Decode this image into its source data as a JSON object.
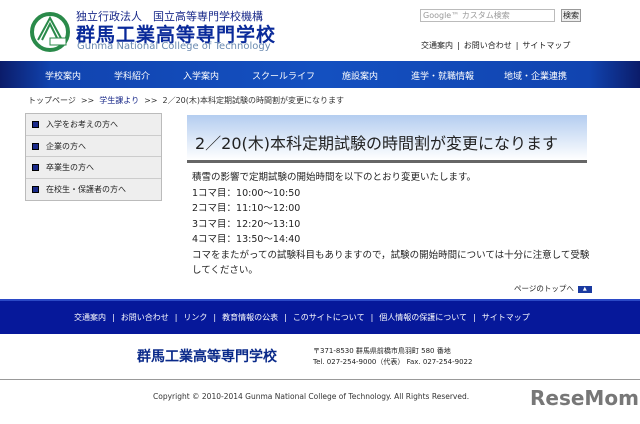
{
  "header": {
    "org": "独立行政法人　国立高等専門学校機構",
    "name": "群馬工業高等専門学校",
    "english_name": "Gunma National College of Technology",
    "search_placeholder": "Google™ カスタム検索",
    "search_button": "検索",
    "links": [
      "交通案内",
      "お問い合わせ",
      "サイトマップ"
    ]
  },
  "nav": [
    "学校案内",
    "学科紹介",
    "入学案内",
    "スクールライフ",
    "施設案内",
    "進学・就職情報",
    "地域・企業連携"
  ],
  "breadcrumb": [
    "トップページ",
    "学生課より",
    "2／20(木)本科定期試験の時間割が変更になります"
  ],
  "breadcrumb_sep": ">>",
  "sidebar": [
    "入学をお考えの方へ",
    "企業の方へ",
    "卒業生の方へ",
    "在校生・保護者の方へ"
  ],
  "article": {
    "title": "2／20(木)本科定期試験の時間割が変更になります",
    "lines": [
      "積雪の影響で定期試験の開始時間を以下のとおり変更いたします。",
      "1コマ目：10:00～10:50",
      "2コマ目：11:10～12:00",
      "3コマ目：12:20～13:10",
      "4コマ目：13:50～14:40",
      "コマをまたがっての試験科目もありますので，試験の開始時間については十分に注意して受験してください。"
    ]
  },
  "page_top": "ページのトップへ",
  "footer": {
    "links": [
      "交通案内",
      "お問い合わせ",
      "リンク",
      "教育情報の公表",
      "このサイトについて",
      "個人情報の保護について",
      "サイトマップ"
    ],
    "name": "群馬工業高等専門学校",
    "address": "〒371-8530 群馬県前橋市鳥羽町 580 番地",
    "tel": "Tel. 027-254-9000（代表） Fax. 027-254-9022",
    "copyright": "Copyright © 2010-2014 Gunma National College of Technology. All Rights Reserved."
  },
  "watermark": "ReseMom"
}
